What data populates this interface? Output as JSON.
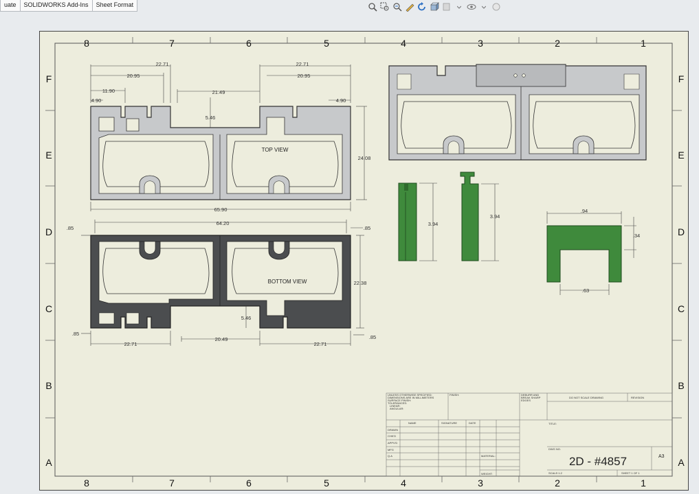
{
  "toolbar": {
    "tabs": [
      "uate",
      "SOLIDWORKS Add-Ins",
      "Sheet Format"
    ],
    "view_icons": [
      "zoom-to-fit-icon",
      "zoom-area-icon",
      "zoom-previous-icon",
      "sketch-icon",
      "rotate-icon",
      "view-orientation-icon",
      "display-style-icon",
      "hide-show-icon",
      "appearance-icon"
    ]
  },
  "sheet": {
    "zones_cols": [
      "8",
      "7",
      "6",
      "5",
      "4",
      "3",
      "2",
      "1"
    ],
    "zones_rows": [
      "F",
      "E",
      "D",
      "C",
      "B",
      "A"
    ]
  },
  "views": {
    "top_view_label": "TOP VIEW",
    "bottom_view_label": "BOTTOM VIEW",
    "colors": {
      "part_light": "#c7c9cb",
      "part_dark": "#4b4d4f",
      "part_green": "#3f8a3c",
      "part_green_dark": "#2f6b2d"
    }
  },
  "dimensions": {
    "top_22_71": "22.71",
    "top_20_95": "20.95",
    "top_11_90": "11.90",
    "top_4_90": "4.90",
    "top_21_49": "21.49",
    "top_5_46": "5.46",
    "top_22_71_r": "22.71",
    "top_20_95_r": "20.95",
    "top_4_90_r": "4.90",
    "top_24_08": "24.08",
    "top_65_90": "65.90",
    "bot_64_20": "64.20",
    "bot_85_tl": ".85",
    "bot_85_tr": ".85",
    "bot_22_38": "22.38",
    "bot_5_46": "5.46",
    "bot_85_bl": ".85",
    "bot_20_49": "20.49",
    "bot_22_71_l": "22.71",
    "bot_22_71_r": "22.71",
    "bot_85_br": ".85",
    "clip_3_94_a": "3.94",
    "clip_3_94_b": "3.94",
    "cap_94": ".94",
    "cap_34": ".34",
    "cap_63": ".63"
  },
  "title_block": {
    "notes": [
      "UNLESS OTHERWISE SPECIFIED:",
      "DIMENSIONS ARE IN MILLIMETERS",
      "SURFACE FINISH:",
      "TOLERANCES:",
      "LINEAR:",
      "ANGULAR:"
    ],
    "finish": "FINISH:",
    "deburr": [
      "DEBURR AND",
      "BREAK SHARP",
      "EDGES"
    ],
    "do_not_scale": "DO NOT SCALE DRAWING",
    "revision": "REVISION",
    "col_name": "NAME",
    "col_signature": "SIGNATURE",
    "col_date": "DATE",
    "rows": [
      "DRAWN",
      "CHK'D",
      "APPV'D",
      "MFG",
      "Q.A"
    ],
    "title": "TITLE:",
    "material": "MATERIAL:",
    "weight": "WEIGHT:",
    "dwg_no_label": "DWG NO.",
    "dwg_no": "2D - #4857",
    "size": "A3",
    "scale": "SCALE:1:2",
    "sheet": "SHEET 1 OF 1"
  }
}
